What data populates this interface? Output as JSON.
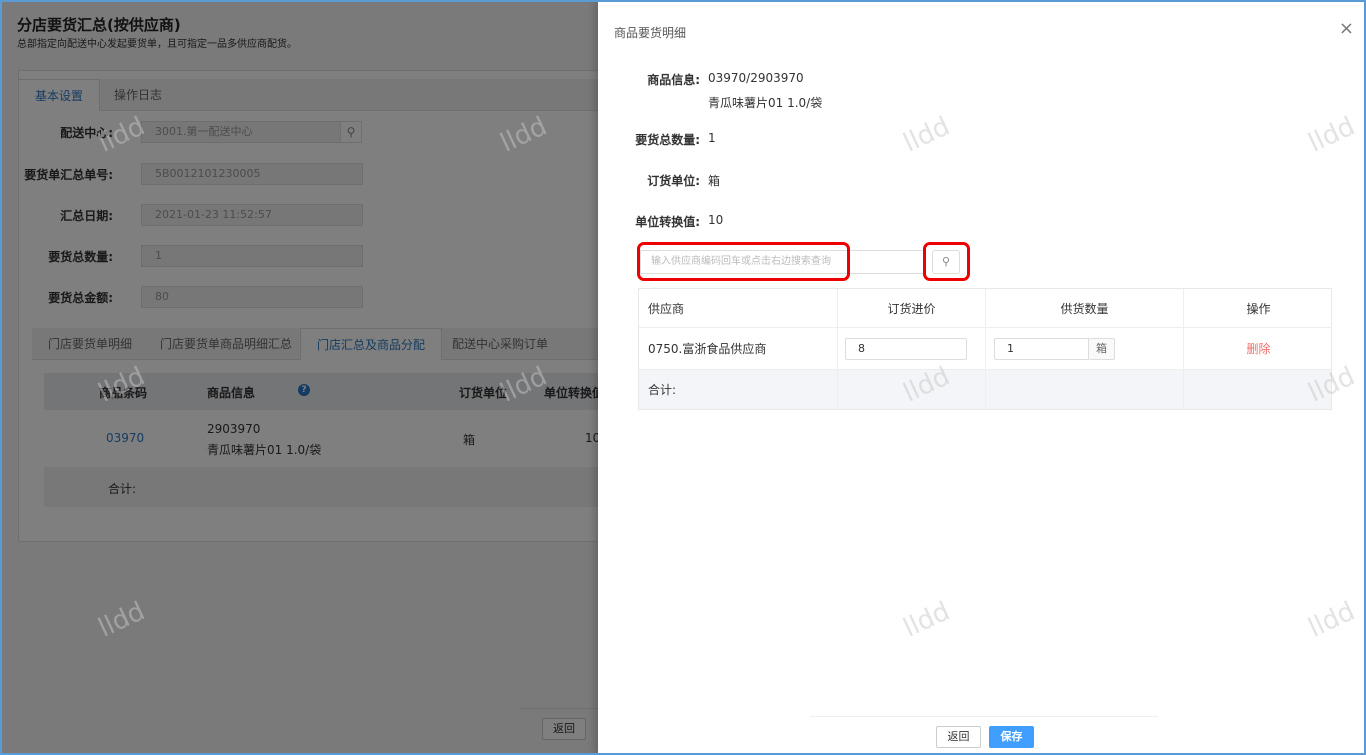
{
  "background": {
    "title": "分店要货汇总(按供应商)",
    "subtitle": "总部指定向配送中心发起要货单，且可指定一品多供应商配货。",
    "tabs": [
      "基本设置",
      "操作日志"
    ],
    "fields": [
      {
        "label": "配送中心:",
        "value": "3001.第一配送中心"
      },
      {
        "label": "要货单汇总单号:",
        "value": "5B0012101230005"
      },
      {
        "label": "汇总日期:",
        "value": "2021-01-23 11:52:57"
      },
      {
        "label": "要货总数量:",
        "value": "1"
      },
      {
        "label": "要货总金额:",
        "value": "80"
      }
    ],
    "sub_tabs": [
      "门店要货单明细",
      "门店要货单商品明细汇总",
      "门店汇总及商品分配",
      "配送中心采购订单"
    ],
    "table": {
      "headers": [
        "商品条码",
        "商品信息",
        "订货单位",
        "单位转换值"
      ],
      "row": {
        "code": "03970",
        "info1": "2903970",
        "info2": "青瓜味薯片01 1.0/袋",
        "unit": "箱",
        "conv": "10"
      },
      "total_label": "合计:"
    },
    "back_button": "返回",
    "watermark": "lldd"
  },
  "drawer": {
    "title": "商品要货明细",
    "close": "×",
    "info": [
      {
        "label": "商品信息:",
        "value": "03970/2903970",
        "value2": "青瓜味薯片01 1.0/袋"
      },
      {
        "label": "要货总数量:",
        "value": "1"
      },
      {
        "label": "订货单位:",
        "value": "箱"
      },
      {
        "label": "单位转换值:",
        "value": "10"
      }
    ],
    "search_placeholder": "输入供应商编码回车或点击右边搜索查询",
    "table": {
      "headers": [
        "供应商",
        "订货进价",
        "供货数量",
        "操作"
      ],
      "row": {
        "supplier": "0750.富浙食品供应商",
        "price": "8",
        "qty": "1",
        "unit": "箱",
        "action": "删除"
      },
      "total_label": "合计:"
    },
    "back_button": "返回",
    "save_button": "保存"
  },
  "colors": {
    "accent": "#409eff",
    "highlight": "#e00000",
    "delete": "#f56c6c"
  }
}
